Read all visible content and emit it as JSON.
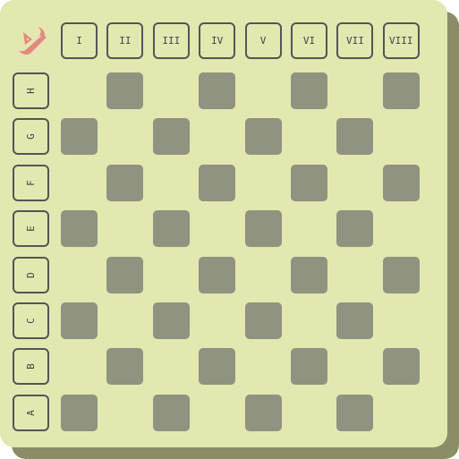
{
  "columns": [
    "I",
    "II",
    "III",
    "IV",
    "V",
    "VI",
    "VII",
    "VIII"
  ],
  "rows": [
    "H",
    "G",
    "F",
    "E",
    "D",
    "C",
    "B",
    "A"
  ],
  "logo_icon": "pink-crown-icon",
  "colors": {
    "board": "#e2e8b0",
    "shadow": "#8a8e67",
    "dark_square": "#8f9380",
    "label_border": "#555555",
    "logo": "#e08a78"
  }
}
